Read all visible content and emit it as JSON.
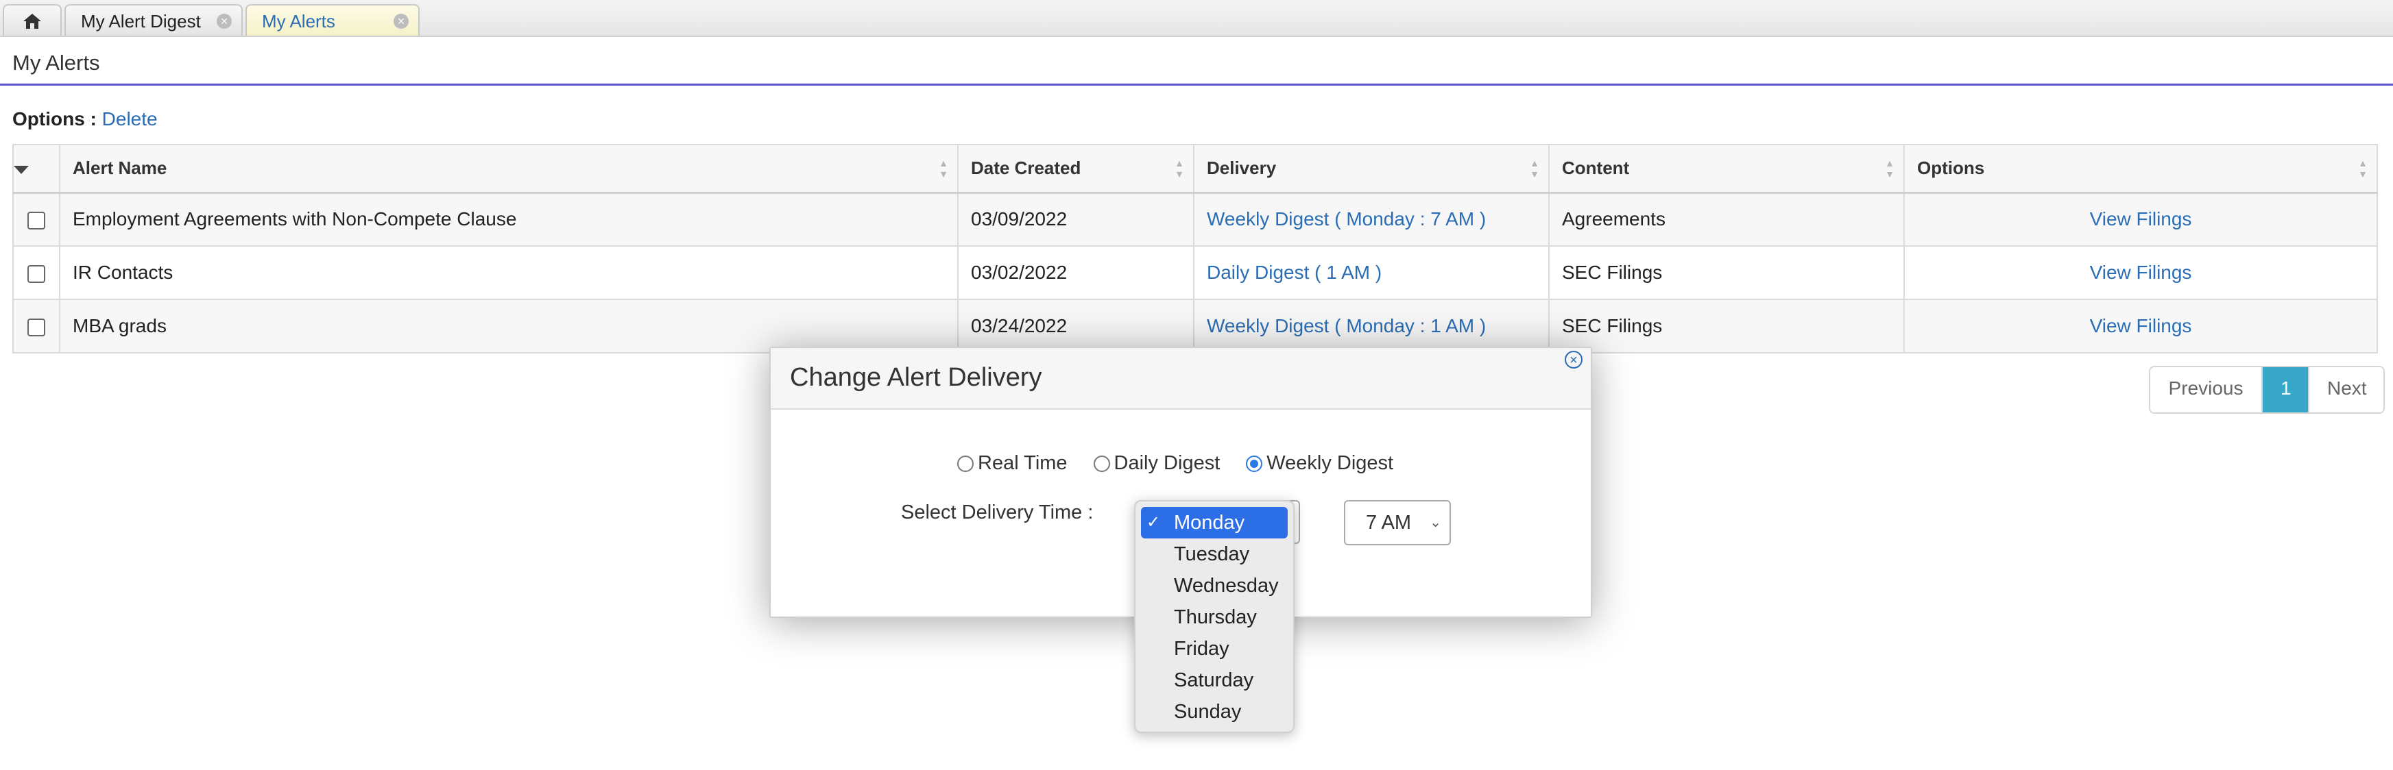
{
  "tabs": [
    {
      "label": "My Alert Digest"
    },
    {
      "label": "My Alerts"
    }
  ],
  "page": {
    "title": "My Alerts",
    "options_label": "Options :",
    "delete_label": "Delete"
  },
  "table": {
    "headers": [
      "Alert Name",
      "Date Created",
      "Delivery",
      "Content",
      "Options"
    ],
    "rows": [
      {
        "name": "Employment Agreements with Non-Compete Clause",
        "date": "03/09/2022",
        "delivery": "Weekly Digest ( Monday : 7 AM )",
        "content": "Agreements",
        "action": "View Filings"
      },
      {
        "name": "IR Contacts",
        "date": "03/02/2022",
        "delivery": "Daily Digest ( 1 AM )",
        "content": "SEC Filings",
        "action": "View Filings"
      },
      {
        "name": "MBA grads",
        "date": "03/24/2022",
        "delivery": "Weekly Digest ( Monday : 1 AM )",
        "content": "SEC Filings",
        "action": "View Filings"
      }
    ]
  },
  "pager": {
    "previous": "Previous",
    "current": "1",
    "next": "Next"
  },
  "modal": {
    "title": "Change Alert Delivery",
    "radios": [
      "Real Time",
      "Daily Digest",
      "Weekly Digest"
    ],
    "selected_radio": "Weekly Digest",
    "delivery_label": "Select Delivery Time :",
    "time_value": "7 AM",
    "days": [
      "Monday",
      "Tuesday",
      "Wednesday",
      "Thursday",
      "Friday",
      "Saturday",
      "Sunday"
    ],
    "selected_day": "Monday"
  },
  "colors": {
    "accent": "#2a6db5",
    "rule": "#5a55c8",
    "pager_active": "#39a7c8",
    "selection": "#2b6ee6"
  }
}
